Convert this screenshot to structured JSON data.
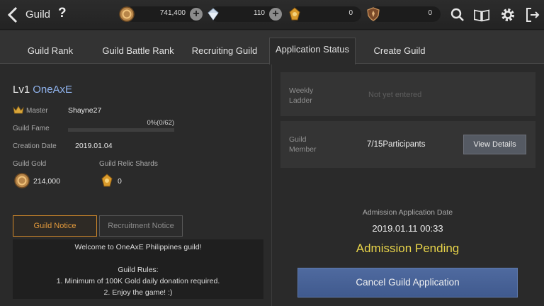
{
  "header": {
    "title": "Guild",
    "help_label": "?",
    "currencies": [
      {
        "icon": "gold-coin-icon",
        "value": "741,400"
      },
      {
        "icon": "diamond-icon",
        "value": "110"
      },
      {
        "icon": "relic-shard-icon",
        "value": "0"
      },
      {
        "icon": "shield-emblem-icon",
        "value": "0"
      }
    ]
  },
  "tabs": [
    {
      "label": "Guild Rank",
      "active": false
    },
    {
      "label": "Guild Battle Rank",
      "active": false
    },
    {
      "label": "Recruiting Guild",
      "active": false
    },
    {
      "label": "Application Status",
      "active": true
    },
    {
      "label": "Create Guild",
      "active": false
    }
  ],
  "guild": {
    "level": "Lv1",
    "name": "OneAxE",
    "master_label": "Master",
    "master": "Shayne27",
    "fame_label": "Guild Fame",
    "fame_text": "0%(0/62)",
    "fame_progress": 0,
    "creation_label": "Creation Date",
    "creation_date": "2019.01.04",
    "gold_label": "Guild Gold",
    "gold": "214,000",
    "shards_label": "Guild Relic Shards",
    "shards": "0"
  },
  "notice_tabs": {
    "guild_notice": "Guild Notice",
    "recruitment_notice": "Recruitment Notice"
  },
  "notice_lines": [
    "Welcome to OneAxE Philippines guild!",
    "",
    "Guild Rules:",
    "1. Minimum of 100K Gold daily donation required.",
    "2. Enjoy the game! :)"
  ],
  "ladder": {
    "label_line1": "Weekly",
    "label_line2": "Ladder",
    "value": "Not yet entered"
  },
  "members": {
    "label_line1": "Guild",
    "label_line2": "Member",
    "value": "7/15Participants",
    "button": "View Details"
  },
  "application": {
    "date_label": "Admission Application Date",
    "date": "2019.01.11 00:33",
    "status": "Admission Pending",
    "cancel_button": "Cancel Guild Application"
  },
  "colors": {
    "accent_orange": "#e39a3c",
    "name_blue": "#8fb2ec",
    "status_yellow": "#e8d44a",
    "button_blue": "#4a6499"
  }
}
